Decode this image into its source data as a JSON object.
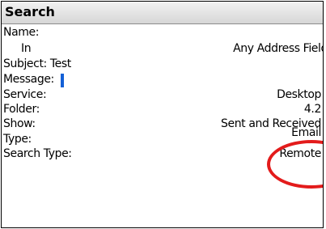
{
  "header": {
    "title": "Search"
  },
  "fields": {
    "name_label": "Name:",
    "in_label": "In",
    "in_value": "Any Address Field",
    "subject_label": "Subject: Test",
    "message_label": "Message:",
    "service_label": "Service:",
    "service_value": "Desktop",
    "folder_label": "Folder:",
    "folder_value": "4.2",
    "show_label": "Show:",
    "show_value": "Sent and Received",
    "type_label": "Type:",
    "type_value": "Email",
    "search_type_label": "Search Type:",
    "search_type_value": "Remote"
  },
  "colors": {
    "annotation_ellipse": "#e31b1b",
    "cursor": "#1460d6"
  }
}
